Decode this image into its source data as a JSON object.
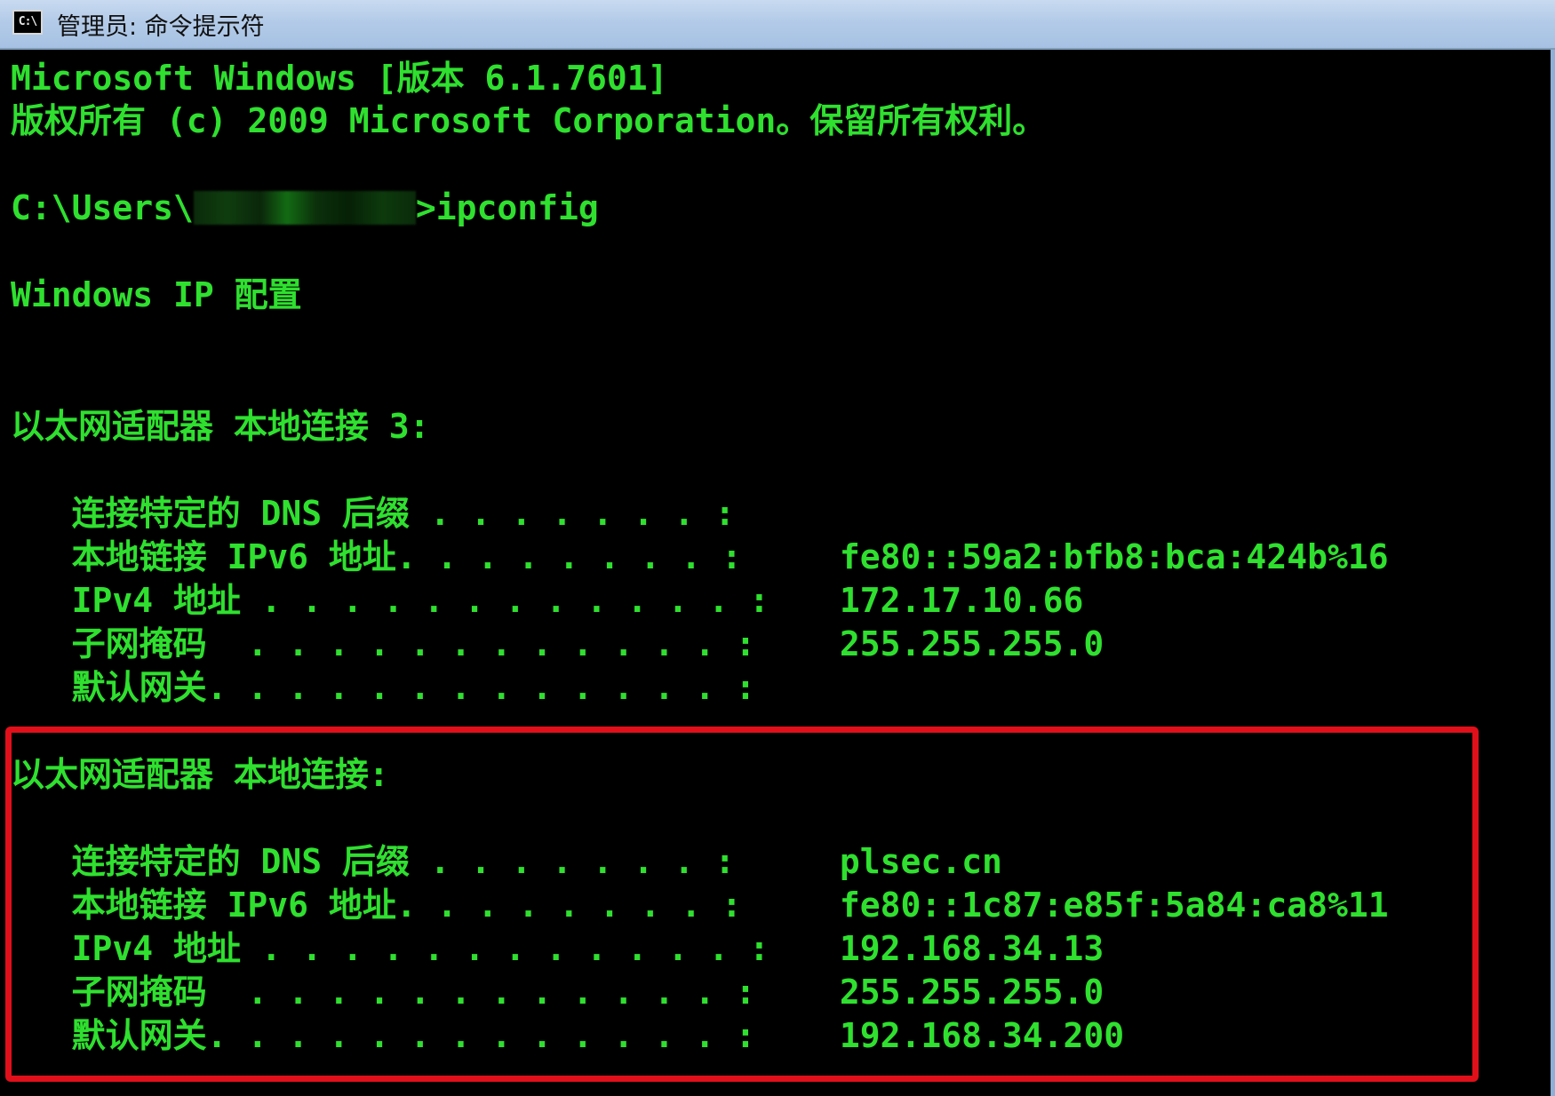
{
  "window": {
    "title": "管理员: 命令提示符",
    "icon_label": "C:\\",
    "icon_name": "cmd-icon"
  },
  "colors": {
    "text": "#2fe02f",
    "background": "#000000",
    "highlight": "#e0101a"
  },
  "console": {
    "header_line1": "Microsoft Windows [版本 6.1.7601]",
    "header_line2": "版权所有 (c) 2009 Microsoft Corporation。保留所有权利。",
    "prompt_prefix": "C:\\Users\\",
    "prompt_command": ">ipconfig",
    "ip_config_title": "Windows IP 配置",
    "adapters": [
      {
        "title": "以太网适配器 本地连接 3:",
        "rows": [
          {
            "label": "   连接特定的 DNS 后缀 . . . . . . . :",
            "value": ""
          },
          {
            "label": "   本地链接 IPv6 地址. . . . . . . . :",
            "value": " fe80::59a2:bfb8:bca:424b%16"
          },
          {
            "label": "   IPv4 地址 . . . . . . . . . . . . :",
            "value": " 172.17.10.66"
          },
          {
            "label": "   子网掩码  . . . . . . . . . . . . :",
            "value": " 255.255.255.0"
          },
          {
            "label": "   默认网关. . . . . . . . . . . . . :",
            "value": ""
          }
        ]
      },
      {
        "title": "以太网适配器 本地连接:",
        "rows": [
          {
            "label": "   连接特定的 DNS 后缀 . . . . . . . :",
            "value": " plsec.cn"
          },
          {
            "label": "   本地链接 IPv6 地址. . . . . . . . :",
            "value": " fe80::1c87:e85f:5a84:ca8%11"
          },
          {
            "label": "   IPv4 地址 . . . . . . . . . . . . :",
            "value": " 192.168.34.13"
          },
          {
            "label": "   子网掩码  . . . . . . . . . . . . :",
            "value": " 255.255.255.0"
          },
          {
            "label": "   默认网关. . . . . . . . . . . . . :",
            "value": " 192.168.34.200"
          }
        ]
      }
    ]
  }
}
